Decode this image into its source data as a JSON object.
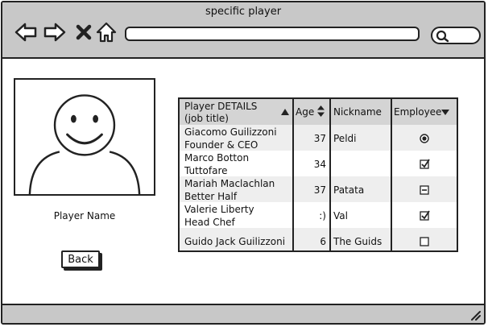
{
  "window": {
    "title": "specific player"
  },
  "browser": {
    "url_value": ""
  },
  "player": {
    "name_label": "Player Name",
    "back_label": "Back"
  },
  "table": {
    "headers": [
      "Player DETAILS",
      "(job title)",
      "Age",
      "Nickname",
      "Employee"
    ],
    "rows": [
      {
        "name": "Giacomo Guilizzoni",
        "title": "Founder & CEO",
        "age": "37",
        "nickname": "Peldi",
        "employee": "radio-selected"
      },
      {
        "name": "Marco Botton",
        "title": "Tuttofare",
        "age": "34",
        "nickname": "",
        "employee": "checked"
      },
      {
        "name": "Mariah Maclachlan",
        "title": "Better Half",
        "age": "37",
        "nickname": "Patata",
        "employee": "indeterminate"
      },
      {
        "name": "Valerie Liberty",
        "title": "Head Chef",
        "age": ":)",
        "nickname": "Val",
        "employee": "checked"
      },
      {
        "name": "Guido Jack Guilizzoni",
        "title": "",
        "age": "6",
        "nickname": "The Guids",
        "employee": "unchecked"
      }
    ]
  },
  "icons": {
    "back": "arrow-left-icon",
    "forward": "arrow-right-icon",
    "stop": "close-icon",
    "home": "home-icon",
    "search": "search-icon",
    "resize": "resize-grip-icon"
  }
}
